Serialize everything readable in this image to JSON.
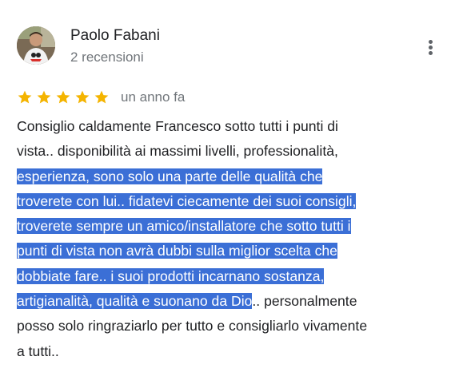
{
  "author": {
    "name": "Paolo Fabani",
    "meta": "2 recensioni",
    "avatar_icon": "profile-photo"
  },
  "more_options_icon": "more-vertical-icon",
  "rating": {
    "stars": 5,
    "max_stars": 5,
    "star_color": "#f4b400",
    "date": "un anno fa"
  },
  "selection_color": "#3b6fd6",
  "review": {
    "lines": [
      {
        "plain": "Consiglio caldamente Francesco sotto tutti i punti di",
        "selected": "",
        "after": ""
      },
      {
        "plain": "vista.. disponibilità ai massimi livelli, professionalità,",
        "selected": "",
        "after": ""
      },
      {
        "plain": "",
        "selected": "esperienza, sono solo una parte delle qualità che",
        "after": ""
      },
      {
        "plain": "",
        "selected": "troverete con lui.. fidatevi ciecamente dei suoi consigli,",
        "after": ""
      },
      {
        "plain": "",
        "selected": "troverete sempre un amico/installatore che sotto tutti i",
        "after": ""
      },
      {
        "plain": "",
        "selected": "punti di vista non avrà dubbi sulla miglior scelta che",
        "after": ""
      },
      {
        "plain": "",
        "selected": "dobbiate fare.. i suoi prodotti incarnano sostanza,",
        "after": ""
      },
      {
        "plain": "",
        "selected": "artigianalità, qualità e suonano da Dio",
        "after": ".. personalmente"
      },
      {
        "plain": "posso solo ringraziarlo per tutto e consigliarlo vivamente",
        "selected": "",
        "after": ""
      },
      {
        "plain": "a tutti..",
        "selected": "",
        "after": ""
      }
    ]
  }
}
